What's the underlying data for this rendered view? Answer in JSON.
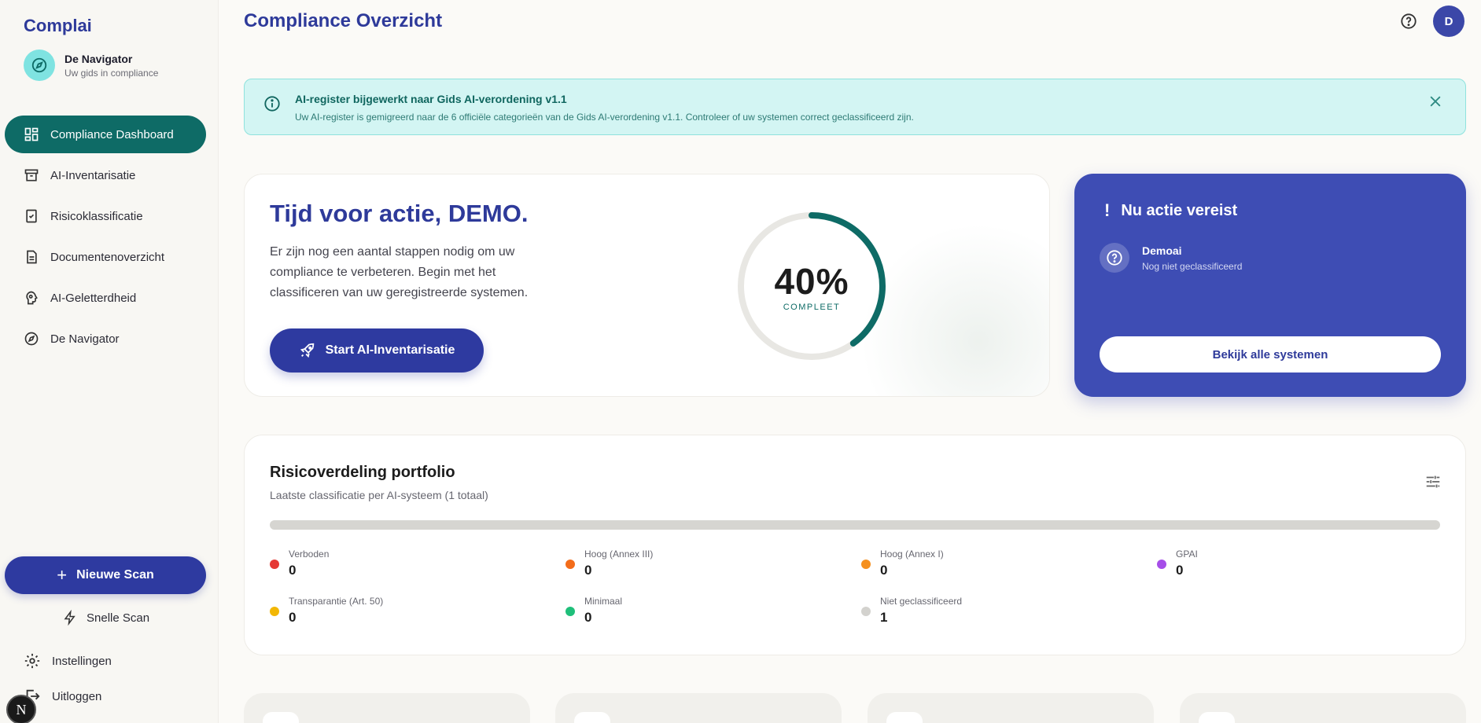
{
  "sidebar": {
    "brand": "Complai",
    "profile": {
      "name": "De Navigator",
      "subtitle": "Uw gids in compliance",
      "icon": "compass-icon"
    },
    "items": [
      {
        "label": "Compliance Dashboard",
        "icon": "dashboard-icon",
        "active": true
      },
      {
        "label": "AI-Inventarisatie",
        "icon": "archive-icon",
        "active": false
      },
      {
        "label": "Risicoklassificatie",
        "icon": "clipboard-check-icon",
        "active": false
      },
      {
        "label": "Documentenoverzicht",
        "icon": "document-icon",
        "active": false
      },
      {
        "label": "AI-Geletterdheid",
        "icon": "brain-icon",
        "active": false
      },
      {
        "label": "De Navigator",
        "icon": "compass-icon",
        "active": false
      }
    ],
    "new_scan_label": "Nieuwe Scan",
    "quick_scan_label": "Snelle Scan",
    "settings_label": "Instellingen",
    "logout_label": "Uitloggen",
    "badge_letter": "N"
  },
  "header": {
    "title": "Compliance Overzicht",
    "avatar_letter": "D"
  },
  "alert": {
    "title": "AI-register bijgewerkt naar Gids AI-verordening v1.1",
    "message": "Uw AI-register is gemigreerd naar de 6 officiële categorieën van de Gids AI-verordening v1.1. Controleer of uw systemen correct geclassificeerd zijn."
  },
  "action": {
    "heading": "Tijd voor actie, DEMO.",
    "description": "Er zijn nog een aantal stappen nodig om uw compliance te verbeteren. Begin met het classificeren van uw geregistreerde systemen.",
    "button_label": "Start AI-Inventarisatie",
    "progress_value": 40,
    "progress_text": "40%",
    "progress_label": "COMPLEET"
  },
  "required": {
    "title": "Nu actie vereist",
    "items": [
      {
        "name": "Demoai",
        "status": "Nog niet geclassificeerd"
      }
    ],
    "button_label": "Bekijk alle systemen"
  },
  "risk": {
    "title": "Risicoverdeling portfolio",
    "subtitle": "Laatste classificatie per AI-systeem (1 totaal)",
    "categories": [
      {
        "label": "Verboden",
        "count": "0",
        "color": "#e53935"
      },
      {
        "label": "Hoog (Annex III)",
        "count": "0",
        "color": "#f36c1a"
      },
      {
        "label": "Hoog (Annex I)",
        "count": "0",
        "color": "#f5901f"
      },
      {
        "label": "GPAI",
        "count": "0",
        "color": "#a64ee8"
      },
      {
        "label": "Transparantie (Art. 50)",
        "count": "0",
        "color": "#f2b705"
      },
      {
        "label": "Minimaal",
        "count": "0",
        "color": "#1fbf7a"
      },
      {
        "label": "Niet geclassificeerd",
        "count": "1",
        "color": "#d3d2ce"
      }
    ]
  },
  "colors": {
    "primary": "#2e3aa0",
    "teal": "#0e6b66",
    "alert_bg": "#d3f5f3"
  }
}
